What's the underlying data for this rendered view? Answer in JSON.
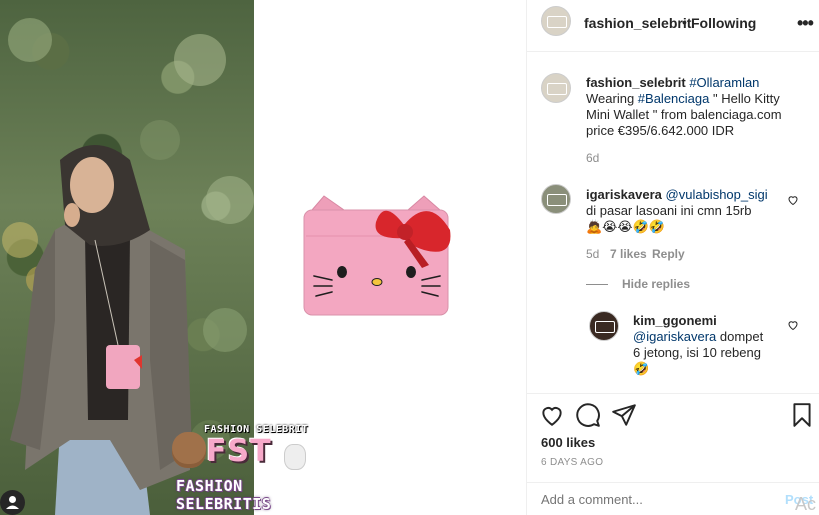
{
  "post": {
    "watermark_small": "FASHION SELEBRIT",
    "watermark_big": "FST",
    "watermark_bottom": "FASHION SELEBRITIS"
  },
  "header": {
    "username": "fashion_selebrit",
    "separator": "•",
    "follow_status": "Following",
    "more_icon": "more-horizontal-icon"
  },
  "caption": {
    "username": "fashion_selebrit",
    "hashtag1": "#Ollaramlan",
    "text1": "Wearing ",
    "hashtag2": "#Balenciaga",
    "text2": " \" Hello Kitty Mini Wallet \" from balenciaga.com price €395/6.642.000 IDR",
    "time": "6d"
  },
  "comments": [
    {
      "username": "igariskavera",
      "mention": "@vulabishop_sigi",
      "text": "di pasar lasoani ini cmn 15rb",
      "emoji": "🙇😭😭🤣🤣",
      "time": "5d",
      "likes": "7 likes",
      "reply": "Reply",
      "hide_replies": "Hide replies"
    },
    {
      "username": "kim_ggonemi",
      "mention": "@igariskavera",
      "text": " dompet 6 jetong, isi 10 rebeng",
      "emoji": "🤣"
    }
  ],
  "actions": {
    "likes": "600 likes",
    "time_ago": "6 DAYS AGO",
    "add_comment_placeholder": "Add a comment...",
    "post_label": "Post",
    "ac_label": "Ac"
  },
  "colors": {
    "text": "#262626",
    "secondary": "#8e8e8e",
    "link": "#00376b",
    "post_button": "#b2dffc",
    "wallet_pink": "#f3a7c1",
    "bow_red": "#d8262c"
  }
}
